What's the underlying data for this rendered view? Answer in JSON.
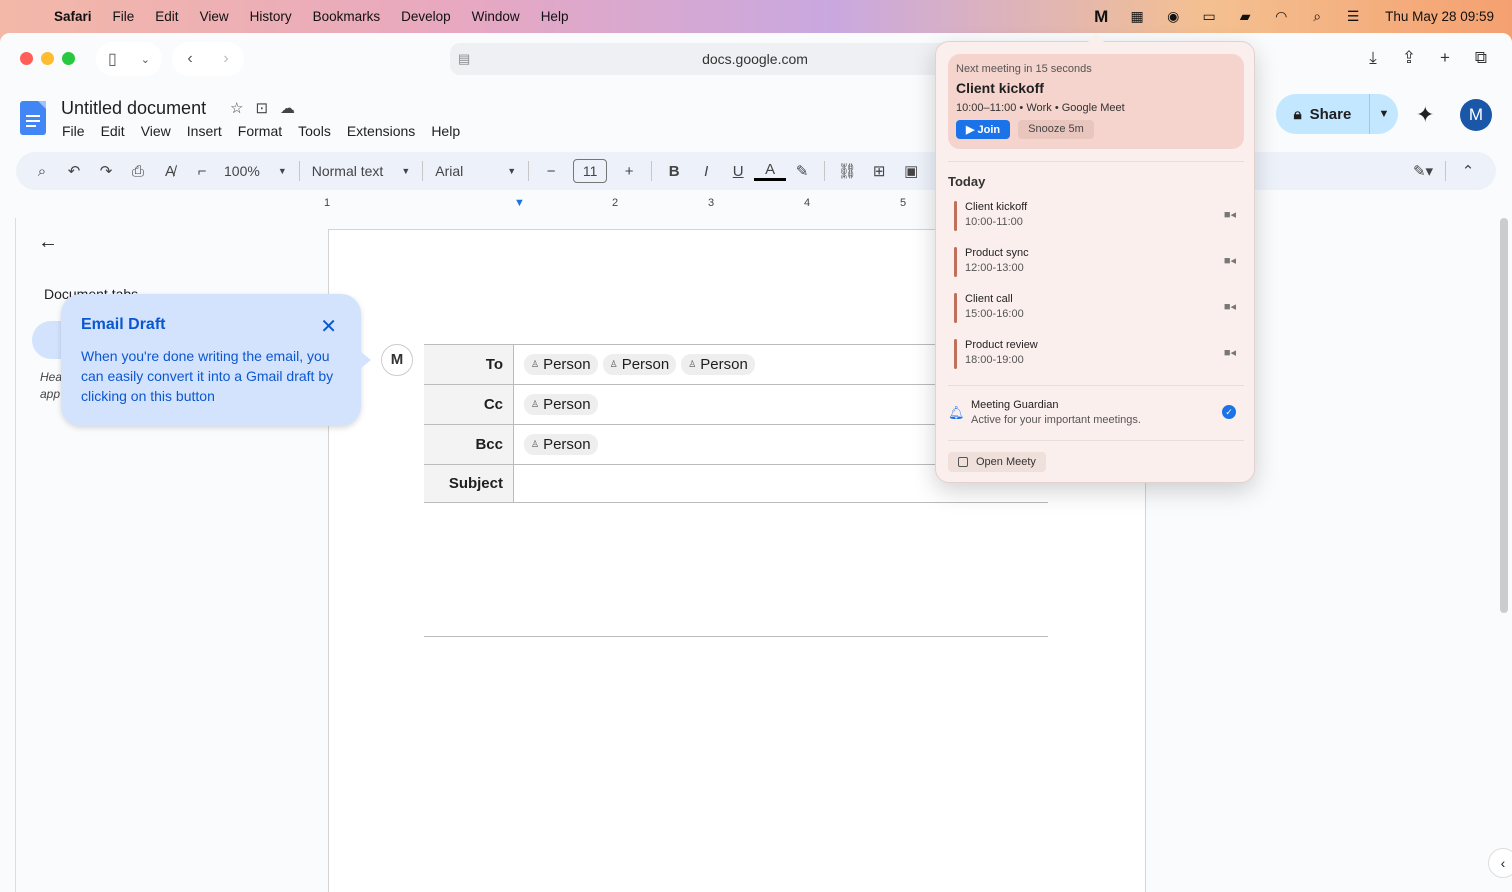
{
  "menubar": {
    "app": "Safari",
    "items": [
      "File",
      "Edit",
      "View",
      "History",
      "Bookmarks",
      "Develop",
      "Window",
      "Help"
    ],
    "clock": "Thu May 28  09:59"
  },
  "browser": {
    "url": "docs.google.com"
  },
  "doc": {
    "title": "Untitled document",
    "menus": [
      "File",
      "Edit",
      "View",
      "Insert",
      "Format",
      "Tools",
      "Extensions",
      "Help"
    ],
    "share_label": "Share",
    "avatar_letter": "M"
  },
  "toolbar": {
    "zoom": "100%",
    "style": "Normal text",
    "font": "Arial",
    "size": "11"
  },
  "ruler": [
    "1",
    "2",
    "3",
    "4",
    "5"
  ],
  "sidebar": {
    "doc_tabs": "Document tabs",
    "heading_hint": "Hea\napp"
  },
  "tooltip": {
    "title": "Email Draft",
    "body": "When you're done writing the email, you can easily convert it into a Gmail draft by clicking on this button"
  },
  "email": {
    "to_label": "To",
    "cc_label": "Cc",
    "bcc_label": "Bcc",
    "subject_label": "Subject",
    "to": [
      "Person",
      "Person",
      "Person"
    ],
    "cc": [
      "Person"
    ],
    "bcc": [
      "Person"
    ]
  },
  "meety": {
    "next_label": "Next meeting in 15 seconds",
    "next_title": "Client kickoff",
    "next_meta": "10:00–11:00 • Work • Google Meet",
    "join_label": "Join",
    "snooze_label": "Snooze 5m",
    "today_label": "Today",
    "events": [
      {
        "name": "Client kickoff",
        "time": "10:00-11:00"
      },
      {
        "name": "Product sync",
        "time": "12:00-13:00"
      },
      {
        "name": "Client call",
        "time": "15:00-16:00"
      },
      {
        "name": "Product review",
        "time": "18:00-19:00"
      }
    ],
    "guardian_title": "Meeting Guardian",
    "guardian_desc": "Active for your important meetings.",
    "open_label": "Open Meety"
  }
}
